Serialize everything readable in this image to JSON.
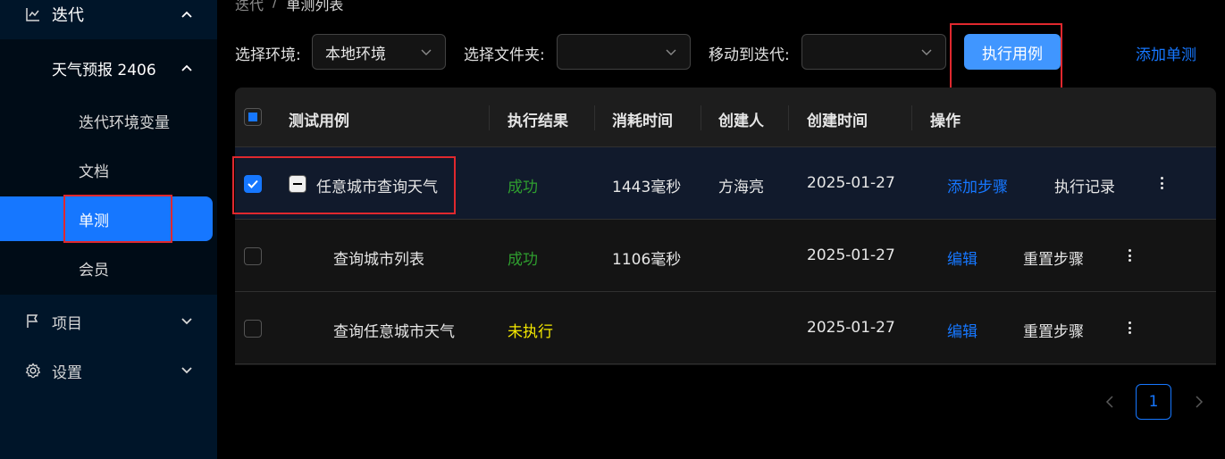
{
  "sidebar": {
    "iteration": "迭代",
    "project_name": "天气预报 2406",
    "items": [
      {
        "label": "迭代环境变量"
      },
      {
        "label": "文档"
      },
      {
        "label": "单测"
      },
      {
        "label": "会员"
      }
    ],
    "projects": "项目",
    "settings": "设置"
  },
  "breadcrumb": {
    "parent": "迭代",
    "separator": "/",
    "current": "单测列表"
  },
  "toolbar": {
    "env_label": "选择环境:",
    "env_value": "本地环境",
    "folder_label": "选择文件夹:",
    "folder_value": "",
    "move_label": "移动到迭代:",
    "move_value": "",
    "run_label": "执行用例",
    "add_label": "添加单测"
  },
  "table": {
    "columns": [
      "测试用例",
      "执行结果",
      "消耗时间",
      "创建人",
      "创建时间",
      "操作"
    ],
    "rows": [
      {
        "name": "任意城市查询天气",
        "result": "成功",
        "duration": "1443毫秒",
        "creator": "方海亮",
        "created": "2025-01-27",
        "action1": "添加步骤",
        "action2": "执行记录"
      },
      {
        "name": "查询城市列表",
        "result": "成功",
        "duration": "1106毫秒",
        "creator": "",
        "created": "2025-01-27",
        "action1": "编辑",
        "action2": "重置步骤"
      },
      {
        "name": "查询任意城市天气",
        "result": "未执行",
        "duration": "",
        "creator": "",
        "created": "2025-01-27",
        "action1": "编辑",
        "action2": "重置步骤"
      }
    ]
  },
  "pagination": {
    "current": "1"
  },
  "colors": {
    "accent": "#1677ff",
    "success": "#2f9e2f",
    "pending": "#f2e600",
    "highlight_box": "#e0282e"
  }
}
